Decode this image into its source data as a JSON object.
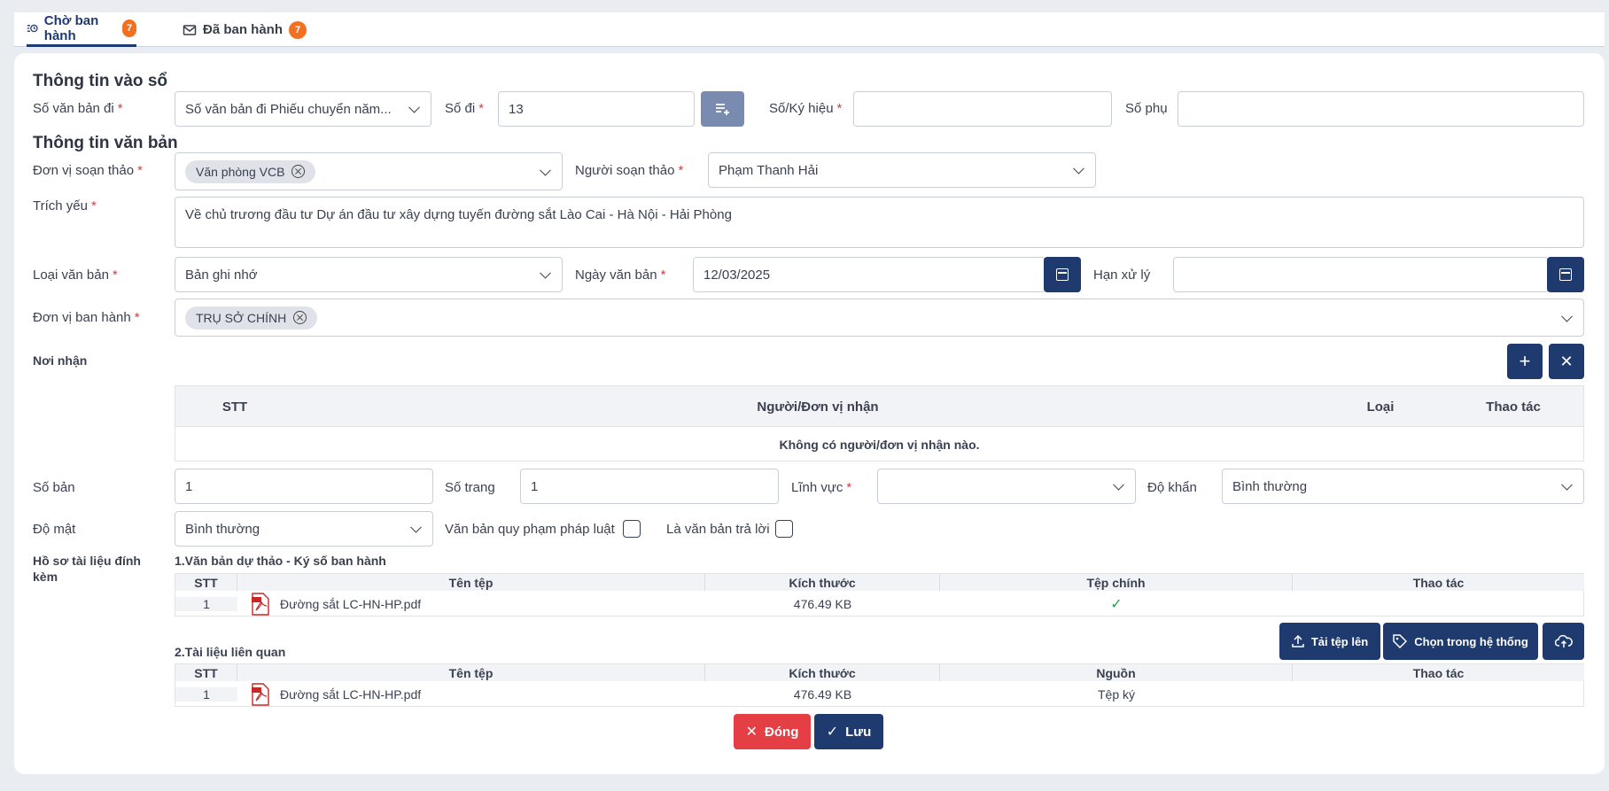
{
  "tabs": [
    {
      "label": "Chờ ban hành",
      "count": "7",
      "active": true
    },
    {
      "label": "Đã ban hành",
      "count": "7",
      "active": false
    }
  ],
  "sections": {
    "registry": "Thông tin vào sổ",
    "document": "Thông tin văn bản"
  },
  "fields": {
    "so_van_ban_di": {
      "label": "Số văn bản đi",
      "value": "Số văn bản đi Phiếu chuyển năm..."
    },
    "so_di": {
      "label": "Số đi",
      "value": "13"
    },
    "so_ky_hieu": {
      "label": "Số/Ký hiệu",
      "value": ""
    },
    "so_phu": {
      "label": "Số phụ",
      "value": ""
    },
    "don_vi_soan_thao": {
      "label": "Đơn vị soạn thảo",
      "chip": "Văn phòng VCB"
    },
    "nguoi_soan_thao": {
      "label": "Người soạn thảo",
      "value": "Phạm Thanh Hải"
    },
    "trich_yeu": {
      "label": "Trích yếu",
      "value": "Về chủ trương đầu tư Dự án đầu tư xây dựng tuyến đường sắt Lào Cai - Hà Nội - Hải Phòng"
    },
    "loai_van_ban": {
      "label": "Loại văn bản",
      "value": "Bản ghi nhớ"
    },
    "ngay_van_ban": {
      "label": "Ngày văn bản",
      "value": "12/03/2025"
    },
    "han_xu_ly": {
      "label": "Hạn xử lý",
      "value": ""
    },
    "don_vi_ban_hanh": {
      "label": "Đơn vị ban hành",
      "chip": "TRỤ SỞ CHÍNH"
    },
    "noi_nhan": {
      "label": "Nơi nhận"
    },
    "so_ban": {
      "label": "Số bản",
      "value": "1"
    },
    "so_trang": {
      "label": "Số trang",
      "value": "1"
    },
    "linh_vuc": {
      "label": "Lĩnh vực",
      "value": ""
    },
    "do_khan": {
      "label": "Độ khẩn",
      "value": "Bình thường"
    },
    "do_mat": {
      "label": "Độ mật",
      "value": "Bình thường"
    },
    "qppl": {
      "label": "Văn bản quy phạm pháp luật",
      "checked": false
    },
    "tra_loi": {
      "label": "Là văn bản trả lời",
      "checked": false
    },
    "ho_so": {
      "label": "Hồ sơ tài liệu đính kèm"
    }
  },
  "recipients_table": {
    "headers": [
      "STT",
      "Người/Đơn vị nhận",
      "Loại",
      "Thao tác"
    ],
    "empty_text": "Không có người/đơn vị nhận nào."
  },
  "attachments": {
    "draft": {
      "title": "1.Văn bản dự thảo - Ký số ban hành",
      "headers": [
        "STT",
        "Tên tệp",
        "Kích thước",
        "Tệp chính",
        "Thao tác"
      ],
      "rows": [
        {
          "stt": "1",
          "name": "Đường sắt LC-HN-HP.pdf",
          "size": "476.49 KB",
          "main": "✓",
          "action": ""
        }
      ]
    },
    "related": {
      "title": "2.Tài liệu liên quan",
      "headers": [
        "STT",
        "Tên tệp",
        "Kích thước",
        "Nguồn",
        "Thao tác"
      ],
      "rows": [
        {
          "stt": "1",
          "name": "Đường sắt LC-HN-HP.pdf",
          "size": "476.49 KB",
          "source": "Tệp ký",
          "action": ""
        }
      ]
    },
    "buttons": {
      "upload": "Tải tệp lên",
      "choose": "Chọn trong hệ thống"
    }
  },
  "footer": {
    "close": "Đóng",
    "save": "Lưu"
  },
  "colors": {
    "primary": "#1f3a6e",
    "danger": "#e53f45",
    "badge": "#f37021",
    "save_icon_bg": "#7a8bb0"
  }
}
